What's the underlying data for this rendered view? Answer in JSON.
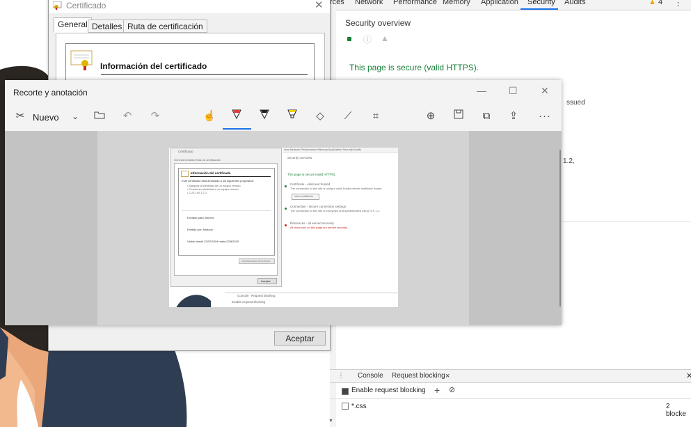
{
  "devtools": {
    "tabs": [
      "rces",
      "Network",
      "Performance",
      "Memory",
      "Application",
      "Security",
      "Audits"
    ],
    "active_tab": "Security",
    "warning_count": "4",
    "security_overview_title": "Security overview",
    "secure_message": "This page is secure (valid HTTPS).",
    "partial_text_1": "ssued",
    "partial_text_2": "1.2,",
    "drawer": {
      "tabs": [
        "Console",
        "Request blocking"
      ],
      "enable_label": "Enable request blocking",
      "pattern": "*.css",
      "count_label": "2 blocke"
    }
  },
  "certificate_dialog": {
    "title": "Certificado",
    "tabs": [
      "General",
      "Detalles",
      "Ruta de certificación"
    ],
    "info_title": "Información del certificado",
    "accept_label": "Aceptar"
  },
  "snip_window": {
    "title": "Recorte y anotación",
    "new_label": "Nuevo",
    "tool_icons": [
      "new-snip-icon",
      "chevron-down-icon",
      "folder-icon",
      "undo-icon",
      "redo-icon",
      "touch-writing-icon",
      "ballpoint-pen-icon",
      "pencil-icon",
      "highlighter-icon",
      "eraser-icon",
      "ruler-icon",
      "crop-icon",
      "zoom-icon",
      "save-icon",
      "copy-icon",
      "share-icon",
      "more-icon"
    ],
    "accent_color": "#1a73e8"
  },
  "thumbnail": {
    "cert_title": "Certificado",
    "cert_tabs": "General  Detalles  Ruta de certificación",
    "info_title": "Información del certificado",
    "line1": "Este certificado está destinado a los siguientes propósitos:",
    "bullet1": "• Asegura la identidad de un equipo remoto",
    "bullet2": "• Prueba su identidad a un equipo remoto",
    "bullet3": "• 2.23.140.1.2.1",
    "issued_to": "Enviado para:  tlbr.info",
    "issued_by": "Emitido por:   Amazon",
    "valid": "Válido desde  22/07/2019  hasta  22/8/2020",
    "issuer_stmt": "Declaración del emisor",
    "accept": "Aceptar",
    "dt_tabs": "rces   Network   Performance   Memory   Application   Security   Audits",
    "sec_overview": "Security overview",
    "secure": "This page is secure (valid HTTPS).",
    "cert_valid_h": "Certificate - valid and trusted",
    "cert_valid_t": "The connection to this site is using a valid, trusted server certificate issued",
    "view_cert": "View certificate",
    "conn_h": "Connection - secure connection settings",
    "conn_t": "The connection to this site is encrypted and authenticated using TLS 1.2,",
    "res_h": "Resources - all served securely",
    "res_t": "All resources on this page are served securely.",
    "console": "Console",
    "reqblock": "Request blocking",
    "enable": "Enable request blocking"
  }
}
